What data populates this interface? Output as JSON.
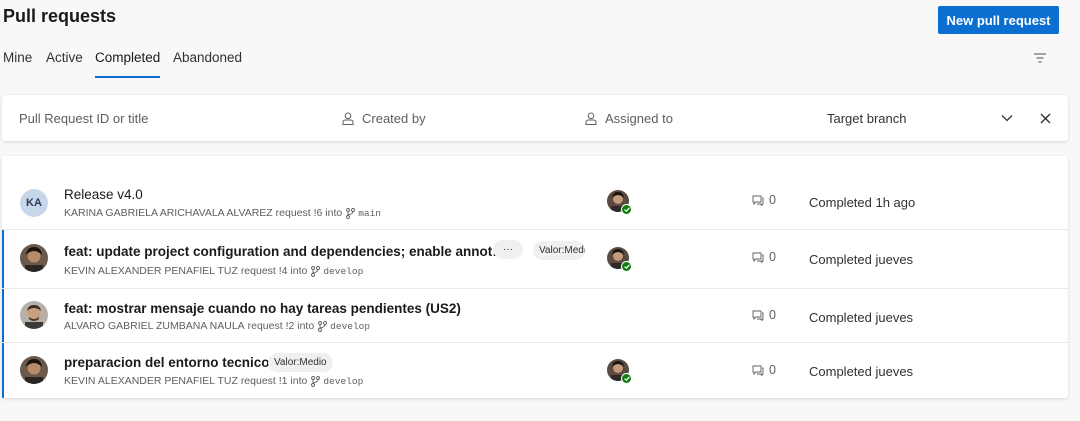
{
  "header": {
    "title": "Pull requests",
    "new_pr_label": "New pull request"
  },
  "tabs": [
    {
      "label": "Mine"
    },
    {
      "label": "Active"
    },
    {
      "label": "Completed",
      "selected": true
    },
    {
      "label": "Abandoned"
    }
  ],
  "filter_bar": {
    "search_placeholder": "Pull Request ID or title",
    "created_by": "Created by",
    "assigned_to": "Assigned to",
    "target_branch": "Target branch"
  },
  "pull_requests": [
    {
      "title": "Release v4.0",
      "author_initials": "KA",
      "author": "KARINA GABRIELA ARICHAVALA ALVAREZ",
      "request_id": "request !6 into",
      "branch": "main",
      "tags": [],
      "reviewer_approved": true,
      "comments": "0",
      "status": "Completed 1h ago"
    },
    {
      "title": "feat: update project configuration and dependencies; enable annot…",
      "author": "KEVIN ALEXANDER PENAFIEL TUZ",
      "request_id": "request !4 into",
      "branch": "develop",
      "more": "···",
      "tags": [
        "Valor:Medio"
      ],
      "reviewer_approved": true,
      "comments": "0",
      "status": "Completed jueves"
    },
    {
      "title": "feat: mostrar mensaje cuando no hay tareas pendientes (US2)",
      "author": "ALVARO GABRIEL ZUMBANA NAULA",
      "request_id": "request !2 into",
      "branch": "develop",
      "tags": [],
      "reviewer_approved": false,
      "comments": "0",
      "status": "Completed jueves"
    },
    {
      "title": "preparacion del entorno tecnico",
      "author": "KEVIN ALEXANDER PENAFIEL TUZ",
      "request_id": "request !1 into",
      "branch": "develop",
      "tags": [
        "Valor:Medio"
      ],
      "reviewer_approved": true,
      "comments": "0",
      "status": "Completed jueves"
    }
  ],
  "colors": {
    "accent": "#0a6fd0",
    "approved": "#107c10"
  }
}
